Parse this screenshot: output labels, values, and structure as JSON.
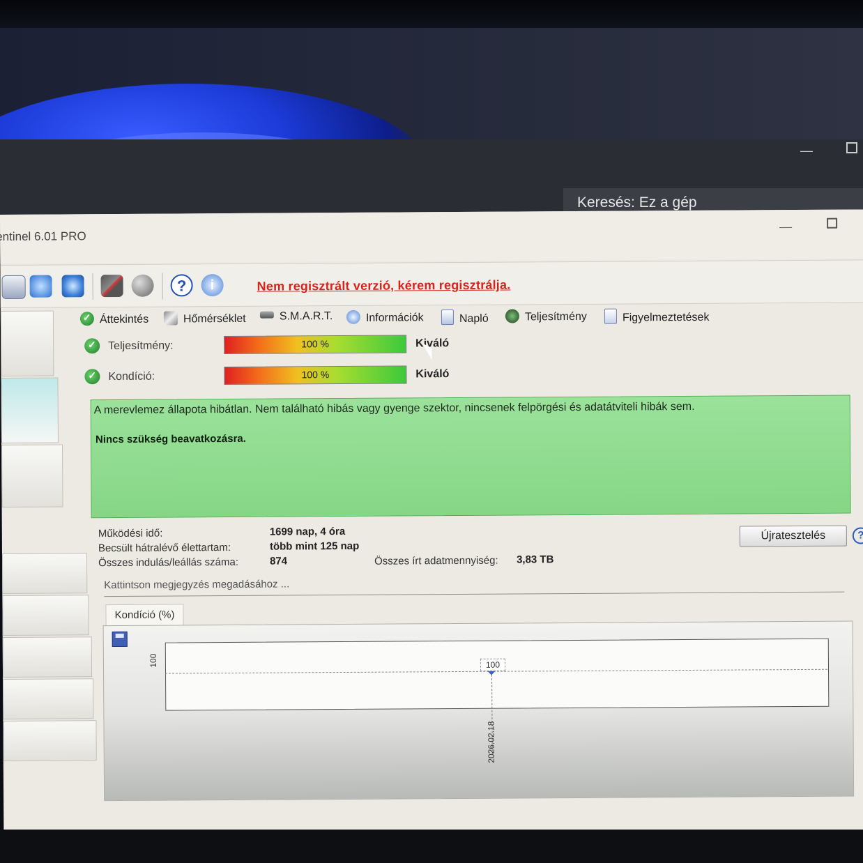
{
  "explorer": {
    "search_placeholder": "Keresés: Ez a gép"
  },
  "app": {
    "title": "entinel 6.01 PRO",
    "nag_text": "Nem regisztrált verzió, kérem regisztrálja."
  },
  "toolbar": {
    "icons": [
      "report-icon",
      "refresh-icon",
      "network-icon",
      "disk-test-icon",
      "sound-icon",
      "help-icon",
      "info-icon"
    ]
  },
  "tabs": [
    {
      "label": "Áttekintés",
      "icon": "check-icon"
    },
    {
      "label": "Hőmérséklet",
      "icon": "thermometer-icon"
    },
    {
      "label": "S.M.A.R.T.",
      "icon": "smart-icon"
    },
    {
      "label": "Információk",
      "icon": "info-icon"
    },
    {
      "label": "Napló",
      "icon": "log-icon"
    },
    {
      "label": "Teljesítmény",
      "icon": "performance-icon"
    },
    {
      "label": "Figyelmeztetések",
      "icon": "alerts-icon"
    }
  ],
  "metrics": {
    "performance": {
      "label": "Teljesítmény:",
      "percent_text": "100 %",
      "percent": 100,
      "grade": "Kiváló"
    },
    "health": {
      "label": "Kondíció:",
      "percent_text": "100 %",
      "percent": 100,
      "grade": "Kiváló"
    }
  },
  "status": {
    "line1": "A merevlemez állapota hibátlan. Nem található hibás vagy gyenge szektor, nincsenek felpörgési és adatátviteli hibák sem.",
    "line2": "Nincs szükség beavatkozásra.",
    "color": "#8fdc8f"
  },
  "info": {
    "uptime_label": "Működési idő:",
    "uptime_value": "1699 nap, 4 óra",
    "life_label": "Becsült hátralévő élettartam:",
    "life_value": "több mint 125 nap",
    "starts_label": "Összes indulás/leállás száma:",
    "starts_value": "874",
    "written_label": "Összes írt adatmennyiség:",
    "written_value": "3,83 TB"
  },
  "buttons": {
    "retest": "Újratesztelés"
  },
  "note": {
    "placeholder": "Kattintson megjegyzés megadásához ..."
  },
  "chart": {
    "tab_label": "Kondíció  (%)"
  },
  "chart_data": {
    "type": "line",
    "title": "",
    "ylabel": "",
    "xlabel": "",
    "y_ticks": [
      "100"
    ],
    "x": [
      "2026.02.18"
    ],
    "series": [
      {
        "values": [
          100
        ]
      }
    ],
    "data_labels": [
      "100"
    ],
    "grid": false
  }
}
